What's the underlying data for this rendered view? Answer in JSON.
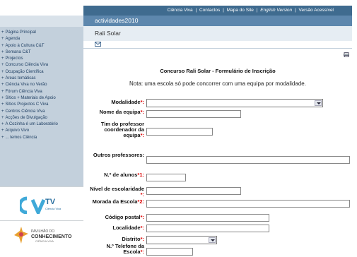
{
  "topbar": {
    "links": [
      "Ciência Viva",
      "Contactos",
      "Mapa do Site",
      "English Version",
      "Versão Acessível"
    ]
  },
  "sidebar": {
    "items": [
      "Página Principal",
      "Agenda",
      "Apoio à Cultura C&T",
      "Semana C&T",
      "Projectos",
      "Concurso Ciência Viva",
      "Ocupação Científica",
      "Áreas temáticas",
      "Ciência Viva no Verão",
      "Fórum Ciência Viva",
      "Sítios + Materiais de Apoio",
      "Sítios Projectos C Viva",
      "Centros Ciência Viva",
      "Acções de Divulgação",
      "A Cozinha é um Laboratório",
      "Arquivo Vivo",
      "... temos Ciência"
    ],
    "logo1_text": "Ciência Viva",
    "logo2_line1": "PAVILHÃO DO",
    "logo2_line2": "CONHECIMENTO",
    "logo2_line3": "CIÊNCIA VIVA"
  },
  "main": {
    "section_title": "actividades2010",
    "page_title": "Rali Solar",
    "form_title": "Concurso Rali Solar - Formulário de Inscrição",
    "form_note": "Nota: uma escola só pode concorrer com uma equipa por modalidade."
  },
  "form": {
    "modalidade": {
      "label": "Modalidade",
      "suffix": "*:",
      "value": ""
    },
    "nome_equipa": {
      "label": "Nome da equipa",
      "suffix": "*:",
      "value": ""
    },
    "tim_professor": {
      "label": "Tim do professor coordenador da equipa",
      "suffix": "*:",
      "value": ""
    },
    "outros_prof": {
      "label": "Outros professores:",
      "value": ""
    },
    "num_alunos": {
      "label": "N.º de alunos",
      "suffix": "*1:",
      "value": ""
    },
    "nivel": {
      "label": "Nível de escolaridade",
      "suffix": " *:",
      "value": ""
    },
    "morada": {
      "label": "Morada da Escola",
      "suffix": "*2:",
      "value": ""
    },
    "codigo_postal": {
      "label": "Código postal",
      "suffix": "*:",
      "value": ""
    },
    "localidade": {
      "label": "Localidade",
      "suffix": "*:",
      "value": ""
    },
    "distrito": {
      "label": "Distrito",
      "suffix": "*:",
      "value": ""
    },
    "telefone": {
      "label": "N.º Telefone da Escola",
      "suffix": "*:",
      "value": ""
    }
  },
  "colors": {
    "topbar": "#3f6b8f",
    "section": "#5d87ad",
    "sidebar": "#c3d0dc",
    "required": "#dd0000"
  }
}
